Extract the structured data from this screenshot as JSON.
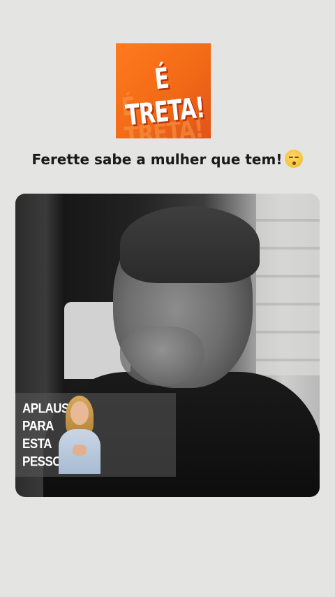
{
  "logo": {
    "text": "É TRETA!",
    "echo": "É TRETA!"
  },
  "caption": {
    "text": "Ferette sabe a mulher que tem!",
    "emoji": "dizzy-face-emoji"
  },
  "video": {
    "overlay": {
      "text": "APLAUSOS PARA ESTA PESSOA"
    }
  }
}
